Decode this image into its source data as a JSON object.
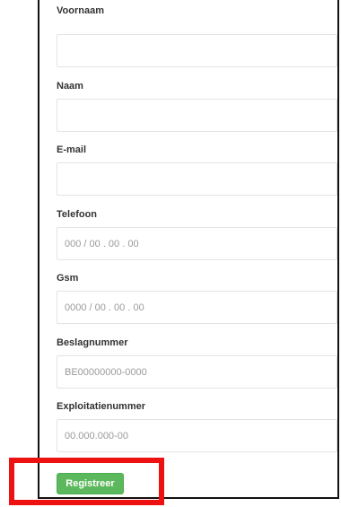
{
  "form": {
    "fields": [
      {
        "label": "Voornaam",
        "value": "",
        "placeholder": ""
      },
      {
        "label": "Naam",
        "value": "",
        "placeholder": ""
      },
      {
        "label": "E-mail",
        "value": "",
        "placeholder": ""
      },
      {
        "label": "Telefoon",
        "value": "",
        "placeholder": "000 / 00 . 00 . 00"
      },
      {
        "label": "Gsm",
        "value": "",
        "placeholder": "0000 / 00 . 00 . 00"
      },
      {
        "label": "Beslagnummer",
        "value": "",
        "placeholder": "BE00000000-0000"
      },
      {
        "label": "Exploitatienummer",
        "value": "",
        "placeholder": "00.000.000-00"
      }
    ],
    "submit_label": "Registreer"
  },
  "colors": {
    "button_green": "#5cb85c",
    "highlight_red": "#ee1111"
  }
}
